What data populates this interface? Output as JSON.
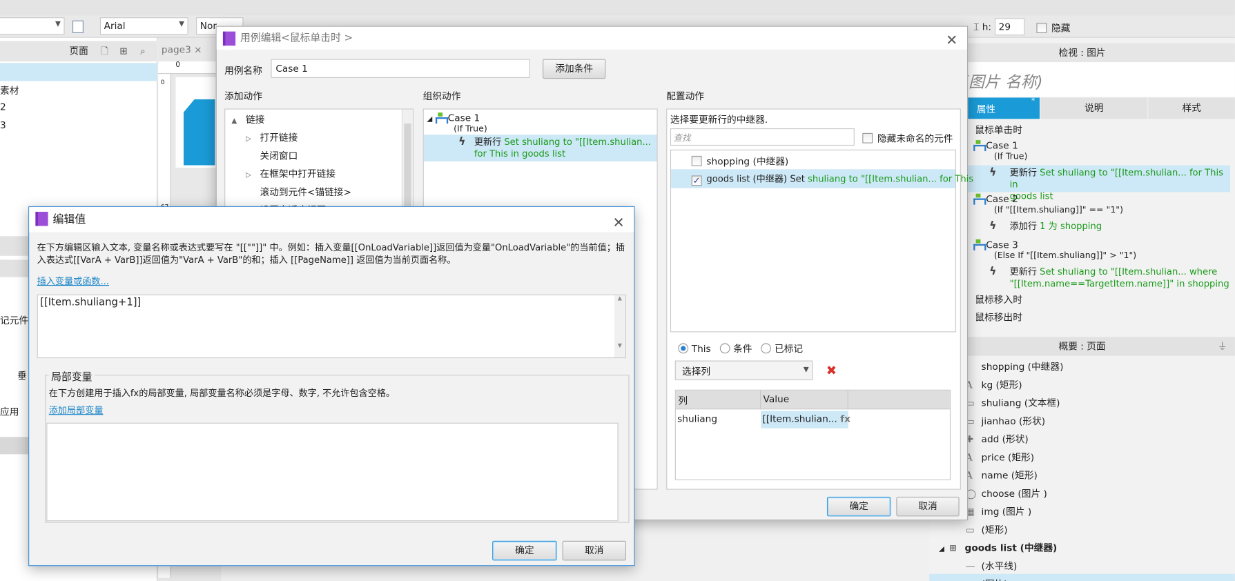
{
  "toolbar": {
    "page_combo": "",
    "font": "Arial",
    "style": "Nor",
    "h_label": "h:",
    "h_value": "29",
    "hidden_label": "隐藏"
  },
  "left_panel": {
    "title": "页面",
    "items": [
      "",
      "素材",
      "2",
      "3"
    ],
    "lower_labels": [
      "记元件",
      "垂",
      "应用"
    ]
  },
  "canvas": {
    "tab": "page3",
    "ruler_top": "0",
    "ruler_left_0": "0",
    "ruler_left_67": "67"
  },
  "case_dialog": {
    "title": "用例编辑<鼠标单击时 >",
    "case_name_label": "用例名称",
    "case_name_value": "Case 1",
    "add_condition": "添加条件",
    "add_action_title": "添加动作",
    "organize_title": "组织动作",
    "configure_title": "配置动作",
    "actions": [
      {
        "label": "链接",
        "level": 0,
        "expander": "▲"
      },
      {
        "label": "打开链接",
        "level": 1,
        "expander": "▷"
      },
      {
        "label": "关闭窗口",
        "level": 1,
        "expander": ""
      },
      {
        "label": "在框架中打开链接",
        "level": 1,
        "expander": "▷"
      },
      {
        "label": "滚动到元件<锚链接>",
        "level": 1,
        "expander": ""
      },
      {
        "label": "设置自适应视图",
        "level": 1,
        "expander": ""
      }
    ],
    "organize": {
      "case": "Case 1",
      "cond": "(If True)",
      "action": "更新行",
      "action_detail": "Set shuliang to \"[[Item.shulian... for This in goods list"
    },
    "configure": {
      "prompt": "选择要更新行的中继器.",
      "search_placeholder": "查找",
      "hide_unnamed": "隐藏未命名的元件",
      "repeaters": [
        {
          "name": "shopping (中继器)",
          "checked": false,
          "detail": ""
        },
        {
          "name": "goods list (中继器) Set",
          "checked": true,
          "detail": "shuliang to \"[[Item.shulian... for This"
        }
      ],
      "radios": [
        "This",
        "条件",
        "已标记"
      ],
      "select_col": "选择列",
      "table": {
        "headers": [
          "列",
          "Value"
        ],
        "rows": [
          {
            "col": "shuliang",
            "value": "[[Item.shulian...",
            "fx": "fx"
          }
        ]
      }
    },
    "ok": "确定",
    "cancel": "取消"
  },
  "edit_dialog": {
    "title": "编辑值",
    "desc": "在下方编辑区输入文本, 变量名称或表达式要写在 \"[[\"\"]]\" 中。例如：插入变量[[OnLoadVariable]]返回值为变量\"OnLoadVariable\"的当前值；插入表达式[[VarA + VarB]]返回值为\"VarA + VarB\"的和；插入 [[PageName]] 返回值为当前页面名称。",
    "insert_link": "插入变量或函数...",
    "value": "[[Item.shuliang+1]]",
    "local_title": "局部变量",
    "local_desc": "在下方创建用于插入fx的局部变量, 局部变量名称必须是字母、数字, 不允许包含空格。",
    "add_local": "添加局部变量",
    "ok": "确定",
    "cancel": "取消"
  },
  "inspector": {
    "header": "检视 : 图片",
    "name_placeholder": "(图片 名称)",
    "tabs": [
      "属性",
      "说明",
      "样式"
    ],
    "events": [
      {
        "type": "event",
        "text": "鼠标单击时"
      },
      {
        "type": "case",
        "text": "Case 1",
        "cond": "(If True)"
      },
      {
        "type": "action",
        "text": "更新行",
        "detail": "Set shuliang to \"[[Item.shulian... for This in",
        "detail2": "goods list",
        "hl": true
      },
      {
        "type": "case",
        "text": "Case 2",
        "cond": "(If \"[[Item.shuliang]]\" == \"1\")"
      },
      {
        "type": "action",
        "text": "添加行",
        "detail": "1 为 shopping",
        "detail2": ""
      },
      {
        "type": "case",
        "text": "Case 3",
        "cond": "(Else If \"[[Item.shuliang]]\" > \"1\")"
      },
      {
        "type": "action",
        "text": "更新行",
        "detail": "Set shuliang to \"[[Item.shulian... where",
        "detail2": "\"[[Item.name==TargetItem.name]]\" in shopping"
      },
      {
        "type": "event",
        "text": "鼠标移入时"
      },
      {
        "type": "event",
        "text": "鼠标移出时"
      }
    ]
  },
  "outline": {
    "header": "概要 : 页面",
    "items": [
      {
        "icon": "repeater",
        "text": "shopping (中继器)"
      },
      {
        "icon": "A",
        "text": "kg (矩形)"
      },
      {
        "icon": "textbox",
        "text": "shuliang (文本框)"
      },
      {
        "icon": "shape",
        "text": "jianhao (形状)"
      },
      {
        "icon": "plus",
        "text": "add (形状)"
      },
      {
        "icon": "A",
        "text": "price (矩形)"
      },
      {
        "icon": "A",
        "text": "name (矩形)"
      },
      {
        "icon": "circle",
        "text": "choose (图片 )"
      },
      {
        "icon": "image",
        "text": "img (图片 )"
      },
      {
        "icon": "shape",
        "text": "(矩形)"
      },
      {
        "icon": "grid",
        "text": "goods list (中继器)"
      },
      {
        "icon": "line",
        "text": "(水平线)"
      },
      {
        "icon": "image",
        "text": "(图片)"
      }
    ]
  },
  "colors": {
    "accent": "#1a9ad6",
    "selection": "#cde8f6",
    "green_text": "#1a9a1a",
    "delete": "#d9302a"
  }
}
